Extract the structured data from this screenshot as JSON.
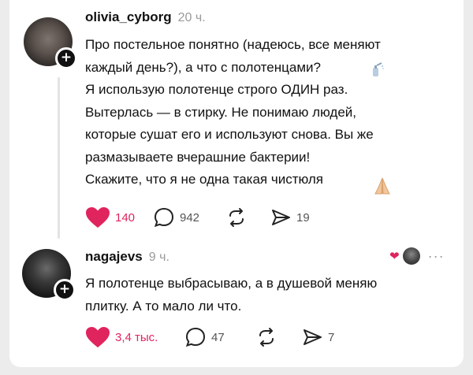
{
  "comments": [
    {
      "username": "olivia_cyborg",
      "time": "20 ч.",
      "text": "Про постельное понятно (надеюсь, все меняют\nкаждый день?), а что с полотенцами?\nЯ использую полотенце строго ОДИН раз.\nВытерлась — в стирку. Не понимаю людей,\nкоторые сушат его и используют снова. Вы же\nразмазываете вчерашние бактерии!\nСкажите, что я не одна такая чистюля",
      "likes": "140",
      "replies": "942",
      "shares": "19",
      "liked": true
    },
    {
      "username": "nagajevs",
      "time": "9 ч.",
      "text": "Я полотенце выбрасываю, а в душевой меняю\nплитку. А то мало ли что.",
      "likes": "3,4 тыс.",
      "replies": "47",
      "shares": "7",
      "liked": true,
      "more": "···"
    }
  ],
  "icons": {
    "like": "heart-icon",
    "reply": "comment-bubble-icon",
    "repost": "repost-icon",
    "share": "send-icon",
    "follow": "plus-icon"
  },
  "colors": {
    "like": "#e0245e",
    "muted": "#9a9a9a"
  }
}
